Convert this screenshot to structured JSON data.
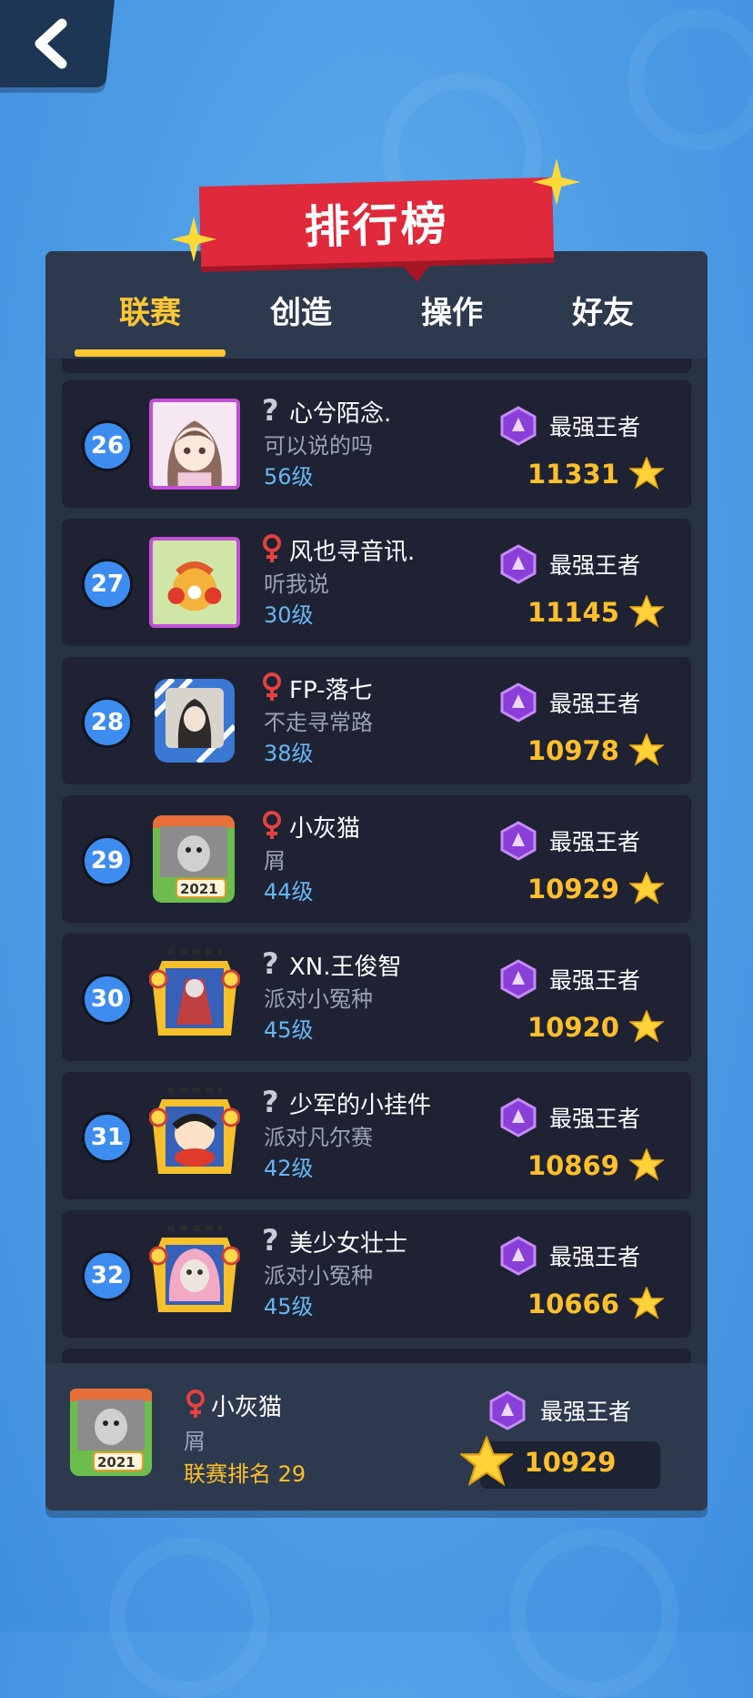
{
  "title": "排行榜",
  "tabs": [
    {
      "label": "联赛",
      "active": true
    },
    {
      "label": "创造",
      "active": false
    },
    {
      "label": "操作",
      "active": false
    },
    {
      "label": "好友",
      "active": false
    }
  ],
  "colors": {
    "accent": "#ffc634",
    "level": "#67b7f3",
    "score": "#ffbf2a",
    "female": "#e3423f",
    "rank_bg": "#3d8cf0",
    "ribbon": "#e0293a"
  },
  "rows": [
    {
      "rank": "26",
      "gender": "unknown",
      "name": "心兮陌念.",
      "signature": "可以说的吗",
      "level": "56级",
      "tier": "最强王者",
      "score": "11331",
      "avatar": "anime-girl-avatar"
    },
    {
      "rank": "27",
      "gender": "female",
      "name": "风也寻音讯.",
      "signature": "听我说",
      "level": "30级",
      "tier": "最强王者",
      "score": "11145",
      "avatar": "tiger-cartoon-avatar"
    },
    {
      "rank": "28",
      "gender": "female",
      "name": "FP-落七",
      "signature": "不走寻常路",
      "level": "38级",
      "tier": "最强王者",
      "score": "10978",
      "avatar": "anime-avatar-blue-frame"
    },
    {
      "rank": "29",
      "gender": "female",
      "name": "小灰猫",
      "signature": "屑",
      "level": "44级",
      "tier": "最强王者",
      "score": "10929",
      "avatar": "husky-2021-avatar"
    },
    {
      "rank": "30",
      "gender": "unknown",
      "name": "XN.王俊智",
      "signature": "派对小冤种",
      "level": "45级",
      "tier": "最强王者",
      "score": "10920",
      "avatar": "mecha-frame-avatar"
    },
    {
      "rank": "31",
      "gender": "unknown",
      "name": "少军的小挂件",
      "signature": "派对凡尔赛",
      "level": "42级",
      "tier": "最强王者",
      "score": "10869",
      "avatar": "crayon-shin-avatar"
    },
    {
      "rank": "32",
      "gender": "unknown",
      "name": "美少女壮士",
      "signature": "派对小冤种",
      "level": "45级",
      "tier": "最强王者",
      "score": "10666",
      "avatar": "pink-hair-meme-avatar"
    }
  ],
  "me": {
    "gender": "female",
    "name": "小灰猫",
    "signature": "屑",
    "league_rank": "联赛排名 29",
    "tier": "最强王者",
    "score": "10929",
    "avatar": "husky-2021-avatar"
  }
}
